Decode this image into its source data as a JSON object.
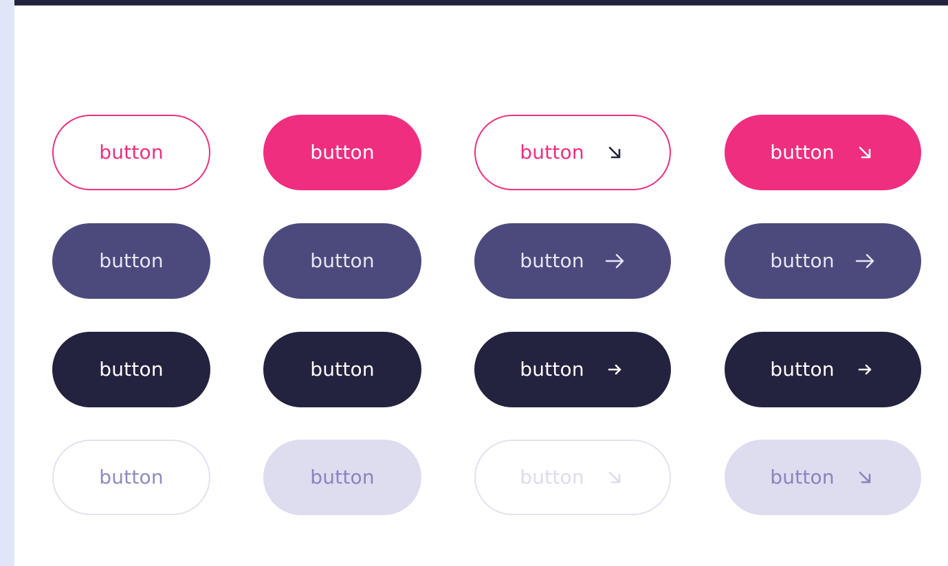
{
  "colors": {
    "pink": "#ef2e80",
    "purple": "#4c4a7d",
    "navy": "#23223f",
    "disabled_bg": "#dedcef",
    "disabled_text": "#8784bd"
  },
  "rows": [
    {
      "name": "pink",
      "buttons": [
        {
          "label": "button",
          "variant": "outline",
          "icon": null
        },
        {
          "label": "button",
          "variant": "solid",
          "icon": null
        },
        {
          "label": "button",
          "variant": "outline",
          "icon": "arrow-down-right-icon"
        },
        {
          "label": "button",
          "variant": "solid",
          "icon": "arrow-down-right-icon"
        }
      ]
    },
    {
      "name": "purple",
      "buttons": [
        {
          "label": "button",
          "variant": "solid",
          "icon": null
        },
        {
          "label": "button",
          "variant": "solid",
          "icon": null
        },
        {
          "label": "button",
          "variant": "solid",
          "icon": "arrow-right-icon"
        },
        {
          "label": "button",
          "variant": "solid",
          "icon": "arrow-right-icon"
        }
      ]
    },
    {
      "name": "navy",
      "buttons": [
        {
          "label": "button",
          "variant": "solid",
          "icon": null
        },
        {
          "label": "button",
          "variant": "solid",
          "icon": null
        },
        {
          "label": "button",
          "variant": "solid",
          "icon": "arrow-right-small-icon"
        },
        {
          "label": "button",
          "variant": "solid",
          "icon": "arrow-right-small-icon"
        }
      ]
    },
    {
      "name": "disabled",
      "buttons": [
        {
          "label": "button",
          "variant": "outline",
          "icon": null
        },
        {
          "label": "button",
          "variant": "solid",
          "icon": null
        },
        {
          "label": "button",
          "variant": "outline",
          "icon": "arrow-down-right-icon"
        },
        {
          "label": "button",
          "variant": "solid",
          "icon": "arrow-down-right-icon"
        }
      ]
    }
  ]
}
